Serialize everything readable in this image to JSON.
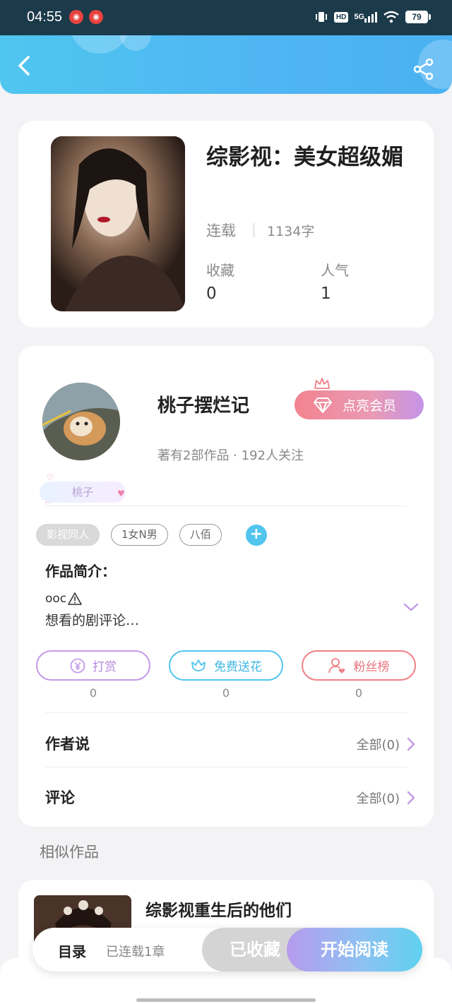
{
  "status_bar": {
    "time": "04:55",
    "network": "5G",
    "hd": "HD",
    "battery": "79"
  },
  "book": {
    "title": "综影视：美女超级媚",
    "status": "连载",
    "words": "1134字",
    "favorites_label": "收藏",
    "favorites_value": "0",
    "popularity_label": "人气",
    "popularity_value": "1"
  },
  "author": {
    "name": "桃子摆烂记",
    "meta": "著有2部作品 · 192人关注",
    "vip_label": "点亮会员",
    "badge": "桃子"
  },
  "tags": [
    "影视同人",
    "1女N男",
    "八佰"
  ],
  "intro": {
    "label": "作品简介：",
    "line1": "ooc",
    "line2": "想看的剧评论…"
  },
  "actions": [
    {
      "label": "打赏",
      "count": "0"
    },
    {
      "label": "免费送花",
      "count": "0"
    },
    {
      "label": "粉丝榜",
      "count": "0"
    }
  ],
  "author_says": {
    "label": "作者说",
    "all": "全部(0)"
  },
  "comments": {
    "label": "评论",
    "all": "全部(0)"
  },
  "similar": {
    "title": "相似作品",
    "books": [
      {
        "title": "综影视重生后的他们"
      }
    ]
  },
  "bottom_bar": {
    "toc_label": "目录",
    "toc_sub": "已连载1章",
    "collected_label": "已收藏",
    "read_label": "开始阅读"
  },
  "colors": {
    "accent_blue": "#4fb5f3",
    "purple": "#c39be6",
    "cyan": "#52c5ee",
    "pink_red": "#f07f86"
  }
}
